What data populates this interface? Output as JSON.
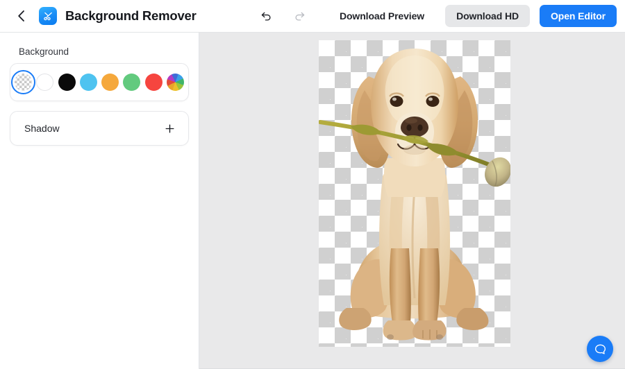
{
  "header": {
    "back_icon": "chevron-left-icon",
    "app_icon": "scissors-icon",
    "title": "Background Remover",
    "undo_icon": "undo-arrow-icon",
    "redo_icon": "redo-arrow-icon",
    "download_preview_label": "Download Preview",
    "download_hd_label": "Download HD",
    "open_editor_label": "Open Editor",
    "accent_color": "#1a7cf7",
    "secondary_button_color": "#e6e7e9",
    "redo_disabled_color": "#b9bcc2"
  },
  "sidebar": {
    "background_section": {
      "label": "Background",
      "swatches": [
        {
          "name": "transparent",
          "color": "transparent",
          "selected": true
        },
        {
          "name": "white",
          "color": "#ffffff",
          "selected": false
        },
        {
          "name": "black",
          "color": "#0a0a0a",
          "selected": false
        },
        {
          "name": "sky-blue",
          "color": "#4ec3f0",
          "selected": false
        },
        {
          "name": "orange",
          "color": "#f5a83c",
          "selected": false
        },
        {
          "name": "green",
          "color": "#62ca7e",
          "selected": false
        },
        {
          "name": "red",
          "color": "#f6453f",
          "selected": false
        },
        {
          "name": "color-picker",
          "color": "multicolor",
          "selected": false
        }
      ]
    },
    "shadow_section": {
      "label": "Shadow",
      "add_icon": "plus-icon"
    }
  },
  "canvas": {
    "background_color": "#e9e9ea",
    "artboard": {
      "transparency_checker": true,
      "checker_size_px": 23,
      "content_alt": "golden retriever puppy sitting, holding a tulip stem in its mouth, background removed"
    }
  },
  "support": {
    "chat_icon": "chat-bubble-icon",
    "chat_color": "#1a7cf7"
  }
}
